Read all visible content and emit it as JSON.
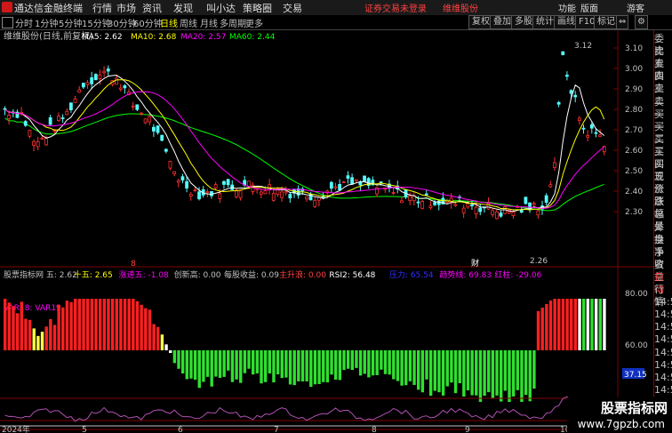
{
  "menubar": {
    "title": "通达信金融终端",
    "menus": [
      "行情",
      "市场",
      "资讯",
      "发现",
      "叫小达",
      "策略圈",
      "交易"
    ],
    "warning": "证券交易未登录",
    "stock_name": "维维股份",
    "right_items": [
      "功能",
      "版面",
      "游客"
    ]
  },
  "periods": [
    "分时",
    "1分钟",
    "5分钟",
    "15分钟",
    "30分钟",
    "60分钟",
    "日线",
    "周线",
    "月线",
    "多周期",
    "更多"
  ],
  "active_period": "日线",
  "toolbar_buttons": [
    "复权",
    "叠加",
    "多股",
    "统计",
    "画线",
    "F10",
    "标记"
  ],
  "main_chart": {
    "stock_label": "维维股份(日线,前复权)",
    "ma_labels": [
      {
        "text": "MA5: 2.62",
        "color": "#ffffff"
      },
      {
        "text": "MA10: 2.68",
        "color": "#ffff00"
      },
      {
        "text": "MA20: 2.57",
        "color": "#ff00ff"
      },
      {
        "text": "MA60: 2.44",
        "color": "#00ff00"
      }
    ],
    "y_ticks": [
      "3.10",
      "3.00",
      "2.90",
      "2.80",
      "2.70",
      "2.60",
      "2.50",
      "2.40",
      "2.30"
    ],
    "high_label": "3.12",
    "low_label": "2.26",
    "marker_left": "8",
    "marker_cai": "财"
  },
  "sub_chart": {
    "indicator_labels": [
      {
        "text": "股票指标网 五: 2.62",
        "color": "#c0c0c0"
      },
      {
        "text": "十五: 2.65",
        "color": "#ffff00"
      },
      {
        "text": "涨速五: -1.08",
        "color": "#ff00ff"
      },
      {
        "text": "创新高: 0.00",
        "color": "#c0c0c0"
      },
      {
        "text": "每股收益: 0.09",
        "color": "#c0c0c0"
      },
      {
        "text": "主升浪: 0.00",
        "color": "#ff4040"
      },
      {
        "text": "RSI2: 56.48",
        "color": "#ffffff"
      },
      {
        "text": "压力: 65.54",
        "color": "#3030ff"
      },
      {
        "text": "趋势线: 69.83",
        "color": "#ff00ff"
      },
      {
        "text": "红柱: -29.06",
        "color": "#ff00ff"
      }
    ],
    "var_label": "VAR18: VAR19",
    "y_ticks": [
      "80.00",
      "60.00",
      "20.00"
    ],
    "current_value": "37.15"
  },
  "x_axis": [
    "2024年",
    "5",
    "6",
    "7",
    "8",
    "9",
    "10"
  ],
  "sidebar": [
    {
      "t": "委比",
      "red": false
    },
    {
      "t": "卖五",
      "red": false
    },
    {
      "t": "卖四",
      "red": false
    },
    {
      "t": "卖三",
      "red": false
    },
    {
      "t": "卖二",
      "red": false
    },
    {
      "t": "卖一",
      "red": false
    },
    {
      "t": "买一",
      "red": false
    },
    {
      "t": "买二",
      "red": false
    },
    {
      "t": "买三",
      "red": false
    },
    {
      "t": "买四",
      "red": false
    },
    {
      "t": "买五",
      "red": false
    },
    {
      "t": "现价",
      "red": false
    },
    {
      "t": "涨跌",
      "red": false
    },
    {
      "t": "涨幅",
      "red": false
    },
    {
      "t": "总量",
      "red": false
    },
    {
      "t": "外盘",
      "red": false
    },
    {
      "t": "换手",
      "red": false
    },
    {
      "t": "净资",
      "red": false
    },
    {
      "t": "收益",
      "red": false
    },
    {
      "t": "自动",
      "red": true
    },
    {
      "t": "行情",
      "red": false
    },
    {
      "t": "14:5",
      "red": false
    },
    {
      "t": "14:5",
      "red": false
    },
    {
      "t": "14:5",
      "red": false
    },
    {
      "t": "14:5",
      "red": false
    },
    {
      "t": "14:5",
      "red": false
    },
    {
      "t": "14:5",
      "red": false
    },
    {
      "t": "14:5",
      "red": false
    },
    {
      "t": "14:5",
      "red": false
    },
    {
      "t": "14:5",
      "red": false
    },
    {
      "t": "14:5",
      "red": false
    }
  ],
  "watermark": {
    "line1": "股票指标网",
    "line2": "www.7gpzb.com"
  },
  "colors": {
    "up": "#ff3030",
    "down": "#54fcfc",
    "ma5": "#ffffff",
    "ma10": "#ffff00",
    "ma20": "#ff00ff",
    "ma60": "#00ff00"
  }
}
